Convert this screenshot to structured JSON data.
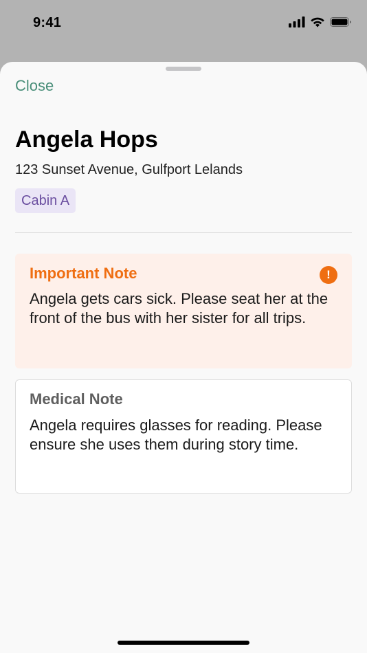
{
  "status_bar": {
    "time": "9:41",
    "icons": [
      "cellular-signal-icon",
      "wifi-icon",
      "battery-icon"
    ]
  },
  "sheet": {
    "close_label": "Close",
    "camper": {
      "name": "Angela Hops",
      "address": "123 Sunset Avenue, Gulfport Lelands",
      "cabin": "Cabin A"
    },
    "important_note": {
      "title": "Important Note",
      "icon": "alert-icon",
      "body": "Angela gets cars sick. Please seat her at the front of the bus with her sister for all trips."
    },
    "medical_note": {
      "title": "Medical Note",
      "body": "Angela requires glasses for reading. Please ensure she uses them during story time."
    }
  },
  "colors": {
    "accent_green": "#4a8f7a",
    "important_orange": "#ef6e12",
    "important_bg": "#fef0ea",
    "cabin_badge_bg": "#eae5f6",
    "cabin_badge_text": "#6b4fa0",
    "overlay_gray": "#b3b3b3",
    "sheet_bg": "#f9f9f9"
  }
}
